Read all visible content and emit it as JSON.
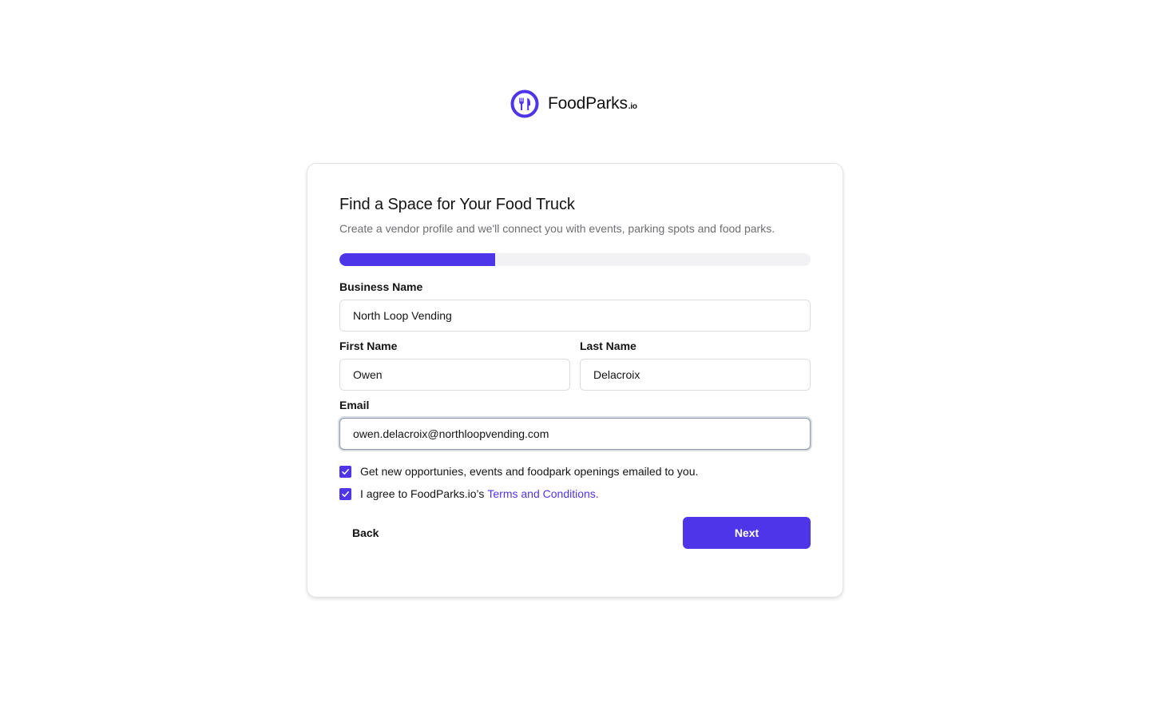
{
  "brand": {
    "name": "FoodParks",
    "suffix": ".io",
    "logo_icon": "fork-knife-icon",
    "accent_color": "#4f35e8"
  },
  "form": {
    "title": "Find a Space for Your Food Truck",
    "subtitle": "Create a vendor profile and we'll connect you with events, parking spots and food parks.",
    "progress_percent": 33,
    "business_name": {
      "label": "Business Name",
      "value": "North Loop Vending"
    },
    "first_name": {
      "label": "First Name",
      "value": "Owen"
    },
    "last_name": {
      "label": "Last Name",
      "value": "Delacroix"
    },
    "email": {
      "label": "Email",
      "value": "owen.delacroix@northloopvending.com"
    },
    "opt_in": {
      "label": "Get new opportunies, events and foodpark openings emailed to you.",
      "checked": true
    },
    "terms": {
      "prefix": "I agree to FoodParks.io’s",
      "link_label": "Terms and Conditions.",
      "checked": true
    },
    "back_label": "Back",
    "next_label": "Next"
  }
}
